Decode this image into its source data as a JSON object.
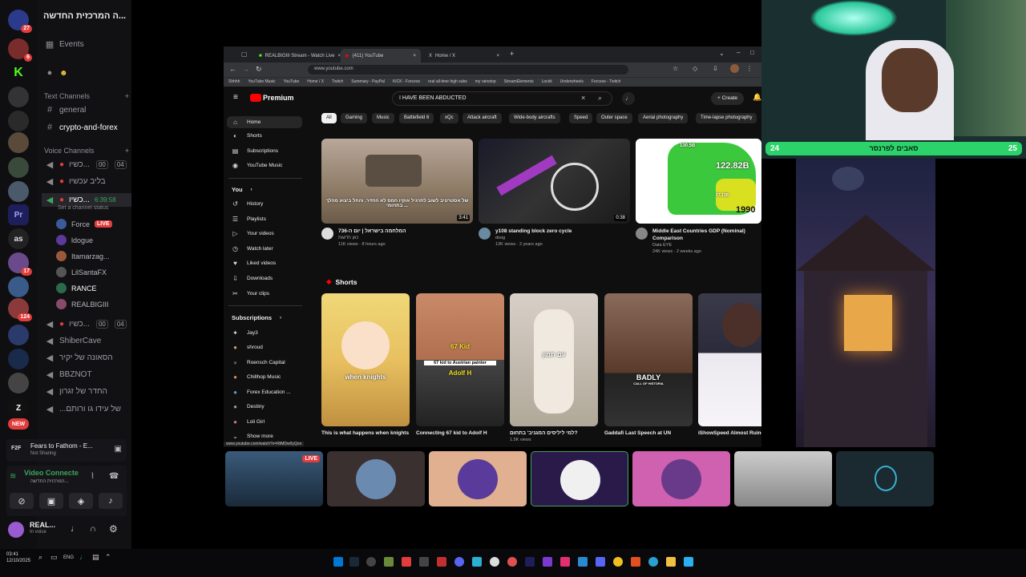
{
  "discord": {
    "server_name": "...ה המרכזית החדשה",
    "rail_badges": [
      "27",
      "6",
      "17",
      "124",
      "NEW"
    ],
    "rail_labels": [
      "Pr",
      "as",
      "Z"
    ],
    "events_label": "Events",
    "text_channels_header": "Text Channels",
    "text_channels": [
      "general",
      "crypto-and-forex"
    ],
    "voice_channels_header": "Voice Channels",
    "voice_channels": [
      {
        "name": "כשיו...",
        "count_a": "00",
        "count_b": "04"
      },
      {
        "name": "בליב עכשיו"
      },
      {
        "name": "כשיו...",
        "timer": "6:39:58",
        "status": "Set a channel status"
      }
    ],
    "voice_users": [
      {
        "name": "Force",
        "live": "LIVE"
      },
      {
        "name": "ldogue"
      },
      {
        "name": "Itamarzag..."
      },
      {
        "name": "LilSantaFX"
      },
      {
        "name": "RANCE"
      },
      {
        "name": "REALBIGIII"
      }
    ],
    "voice_channels_more": [
      {
        "name": "כשיו...",
        "count_a": "00",
        "count_b": "04"
      },
      {
        "name": "ShiberCave"
      },
      {
        "name": "הסאונה של יקיר"
      },
      {
        "name": "BBZNOT"
      },
      {
        "name": "החדר של זגרון"
      },
      {
        "name": "...של עידו גו ורותם"
      }
    ],
    "activity": {
      "title": "Fears to Fathom - E...",
      "status": "Not Sharing",
      "badge": "F2F"
    },
    "voice_panel": {
      "title": "Video Connecte",
      "subtitle": "המרכזית החדשה..."
    },
    "user": {
      "name": "REAL...",
      "status": "In voice"
    }
  },
  "taskbar": {
    "time": "03:41",
    "date": "12/10/2025",
    "lang": "ENG"
  },
  "browser": {
    "tabs": [
      "REALBIGIII Stream - Watch Live",
      "(411) YouTube",
      "Home / X"
    ],
    "url": "www.youtube.com",
    "bookmarks": [
      "Shhhh",
      "YouTube Music",
      "YouTube",
      "Home / X",
      "Twitch",
      "Summary - PayPal",
      "KICK - Forcexe",
      "real all-time high subs",
      "my rainstop",
      "StreamElements",
      "Lockit",
      "Underwheels",
      "Forcexe - Twitch"
    ]
  },
  "youtube": {
    "logo": "Premium",
    "search": "I HAVE BEEN ABDUCTED",
    "create": "Create",
    "nav": [
      "Home",
      "Shorts",
      "Subscriptions",
      "YouTube Music"
    ],
    "you_header": "You",
    "you_items": [
      "History",
      "Playlists",
      "Your videos",
      "Watch later",
      "Liked videos",
      "Downloads",
      "Your clips"
    ],
    "subs_header": "Subscriptions",
    "subs": [
      "Jay3",
      "shroud",
      "Roensch Capital",
      "Chillhop Music",
      "Forex Education ...",
      "Destiny",
      "Loli Girl"
    ],
    "show_more": "Show more",
    "chips": [
      "All",
      "Gaming",
      "Music",
      "Battlefield 6",
      "xQc",
      "Attack aircraft",
      "Wide-body aircrafts",
      "Speed",
      "Outer space",
      "Aerial photography",
      "Time-lapse photography"
    ],
    "videos": [
      {
        "title": "המלחמה בישראל | יום ה-736",
        "channel": "כאן חדשות",
        "stats": "11K views · 8 hours ago",
        "duration": "3:41",
        "overlay": "של אסטרטיב לשוב לתרגיל אוקיו חמס לא החזיר. והחל ביצוע מהלך בתחומי ..."
      },
      {
        "title": "y108 standing block zero cycle",
        "channel": "doog",
        "stats": "13K views · 2 years ago",
        "duration": "0:38"
      },
      {
        "title": "Middle East Countries GDP (Nominal) Comparison",
        "channel": "Data EYE",
        "stats": "24K views · 2 weeks ago",
        "duration": "3:01",
        "overlay_value": "122.82B",
        "overlay_year": "1990",
        "overlay_small": "130.5B",
        "overlay_small2": "67.13B"
      }
    ],
    "shorts_header": "Shorts",
    "shorts": [
      {
        "title": "This is what happens when knights mistake soldiers f...",
        "overlay": "when knights"
      },
      {
        "title": "Connecting 67 kid to Adolf H",
        "overlay": "67 Kid",
        "overlay2": "67 kid to Austrian painter",
        "overlay3": "Adolf H"
      },
      {
        "title": "למי ליליסים המגניב' בתחום?",
        "overlay": "עם תמון",
        "stats": "1.5K views"
      },
      {
        "title": "Gaddafi Last Speech at UN",
        "overlay": "BADLY",
        "overlay2": "CALL OF HISTORIA"
      },
      {
        "title": "iShowSpeed Almost Ruined A Fan's Career"
      }
    ],
    "status_url": "www.youtube.com/watch?v=RtMDw0yQoo"
  },
  "webcam": {
    "bar_text": "סאבים לפרנסר",
    "left_count": "24",
    "right_count": "25"
  },
  "tiles": [
    {
      "live": "LIVE"
    }
  ]
}
